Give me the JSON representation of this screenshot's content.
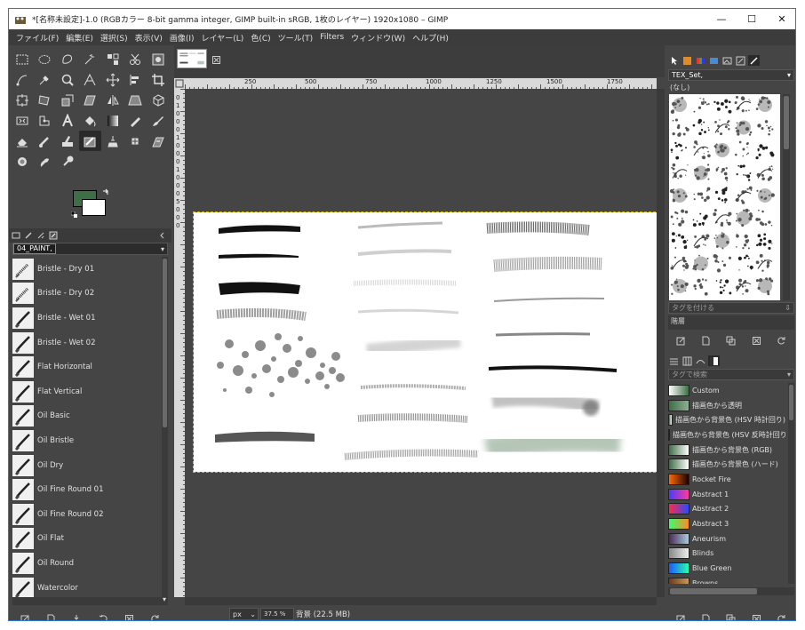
{
  "window": {
    "title": "*[名称未設定]-1.0 (RGBカラー 8-bit gamma integer, GIMP built-in sRGB, 1枚のレイヤー) 1920x1080 – GIMP",
    "minimize": "—",
    "maximize": "☐",
    "close": "✕"
  },
  "menu": [
    "ファイル(F)",
    "編集(E)",
    "選択(S)",
    "表示(V)",
    "画像(I)",
    "レイヤー(L)",
    "色(C)",
    "ツール(T)",
    "Filters",
    "ウィンドウ(W)",
    "ヘルプ(H)"
  ],
  "colors": {
    "foreground": "#3d6e45",
    "background": "#ffffff",
    "accent": "#2b78d4",
    "selection": "#d8c000"
  },
  "tool_icons": [
    "rect-select-icon",
    "ellipse-select-icon",
    "free-select-icon",
    "fuzzy-select-icon",
    "select-by-color-icon",
    "scissors-select-icon",
    "foreground-select-icon",
    "paths-icon",
    "color-picker-icon",
    "zoom-icon",
    "measure-icon",
    "move-icon",
    "align-icon",
    "crop-icon",
    "unified-transform-icon",
    "rotate-icon",
    "scale-icon",
    "shear-icon",
    "flip-icon",
    "perspective-icon",
    "3d-transform-icon",
    "warp-transform-icon",
    "handle-transform-icon",
    "text-icon",
    "bucket-fill-icon",
    "gradient-icon",
    "pencil-icon",
    "paintbrush-icon",
    "eraser-icon",
    "airbrush-icon",
    "ink-icon",
    "mypaint-brush-icon",
    "clone-icon",
    "heal-icon",
    "perspective-clone-icon",
    "blur-icon",
    "smudge-icon",
    "dodge-burn-icon"
  ],
  "brushes_panel": {
    "tag": "04_PAINT,",
    "items": [
      "Bristle - Dry  01",
      "Bristle - Dry 02",
      "Bristle - Wet 01",
      "Bristle - Wet 02",
      "Flat Horizontal",
      "Flat Vertical",
      "Oil Basic",
      "Oil Bristle",
      "Oil Dry",
      "Oil Fine Round 01",
      "Oil Fine Round 02",
      "Oil Flat",
      "Oil Round",
      "Watercolor"
    ]
  },
  "ruler": {
    "h_labels": [
      "250",
      "500",
      "750",
      "1000",
      "1250",
      "1500",
      "1750"
    ],
    "v_labels": [
      "0",
      "1",
      "0",
      "0",
      "0",
      "1",
      "0",
      "0",
      "0",
      "1",
      "0",
      "0",
      "0",
      "5",
      "0",
      "0",
      "0"
    ]
  },
  "status": {
    "unit": "px",
    "zoom": "37.5 %",
    "layer": "背景 (22.5 MB)"
  },
  "right_panel": {
    "tag": "TEX_Set,",
    "sub": "(なし)",
    "tag_placeholder": "タグを付ける",
    "section_label": "階層",
    "search_placeholder": "タグで検索",
    "gradients": [
      {
        "name": "Custom",
        "c1": "#ffffff",
        "c2": "#3d6e45"
      },
      {
        "name": "描画色から透明",
        "c1": "#3d6e45",
        "c2": "#8fae94"
      },
      {
        "name": "描画色から背景色 (HSV 時計回り)",
        "c1": "#3d6e45",
        "c2": "#ffffff"
      },
      {
        "name": "描画色から背景色 (HSV 反時計回り)",
        "c1": "#3d6e45",
        "c2": "#ffffff"
      },
      {
        "name": "描画色から背景色 (RGB)",
        "c1": "#3d6e45",
        "c2": "#ffffff"
      },
      {
        "name": "描画色から背景色 (ハード)",
        "c1": "#3d6e45",
        "c2": "#ffffff"
      },
      {
        "name": "Rocket Fire",
        "c1": "#ff6a00",
        "c2": "#1a0000"
      },
      {
        "name": "Abstract 1",
        "c1": "#4a3aff",
        "c2": "#ff3a9a"
      },
      {
        "name": "Abstract 2",
        "c1": "#ff2a4a",
        "c2": "#2a4aff"
      },
      {
        "name": "Abstract 3",
        "c1": "#3aff6a",
        "c2": "#ff8a2a"
      },
      {
        "name": "Aneurism",
        "c1": "#4a2a5a",
        "c2": "#aaccdd"
      },
      {
        "name": "Blinds",
        "c1": "#888888",
        "c2": "#eeeeee"
      },
      {
        "name": "Blue Green",
        "c1": "#1a5aff",
        "c2": "#2affaa"
      },
      {
        "name": "Browns",
        "c1": "#6a3a1a",
        "c2": "#c89a5a"
      }
    ]
  }
}
